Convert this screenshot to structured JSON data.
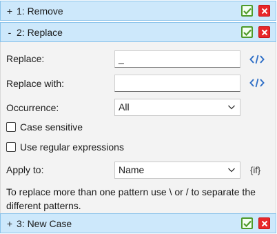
{
  "sections": [
    {
      "toggle": "+",
      "title": "1: Remove"
    },
    {
      "toggle": "-",
      "title": "2: Replace"
    },
    {
      "toggle": "+",
      "title": "3: New Case"
    }
  ],
  "form": {
    "replace_label": "Replace:",
    "replace_value": "_",
    "replace_with_label": "Replace with:",
    "replace_with_value": "",
    "occurrence_label": "Occurrence:",
    "occurrence_value": "All",
    "case_sensitive_label": "Case sensitive",
    "case_sensitive_checked": false,
    "regex_label": "Use regular expressions",
    "regex_checked": false,
    "apply_to_label": "Apply to:",
    "apply_to_value": "Name",
    "if_label": "{if}",
    "note": "To replace more than one pattern use \\ or / to separate the different patterns."
  },
  "colors": {
    "header_bg": "#cde8fb",
    "ok_green": "#4e9a2a",
    "close_red": "#e8272a",
    "code_icon_blue": "#2f6fc7"
  }
}
